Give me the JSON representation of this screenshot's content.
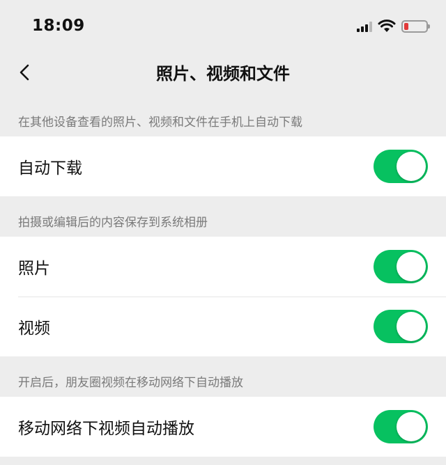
{
  "status_bar": {
    "time": "18:09",
    "icons": [
      "cellular-signal-icon",
      "wifi-icon",
      "battery-low-icon"
    ]
  },
  "nav": {
    "title": "照片、视频和文件",
    "back_icon": "chevron-left-icon"
  },
  "sections": [
    {
      "header": "在其他设备查看的照片、视频和文件在手机上自动下载",
      "cells": [
        {
          "label": "自动下载",
          "toggle_on": true
        }
      ]
    },
    {
      "header": "拍摄或编辑后的内容保存到系统相册",
      "cells": [
        {
          "label": "照片",
          "toggle_on": true
        },
        {
          "label": "视频",
          "toggle_on": true
        }
      ]
    },
    {
      "header": "开启后，朋友圈视频在移动网络下自动播放",
      "cells": [
        {
          "label": "移动网络下视频自动播放",
          "toggle_on": true
        }
      ]
    }
  ],
  "colors": {
    "toggle_on": "#07c160",
    "background": "#ededed",
    "battery_low": "#e23a3a"
  }
}
